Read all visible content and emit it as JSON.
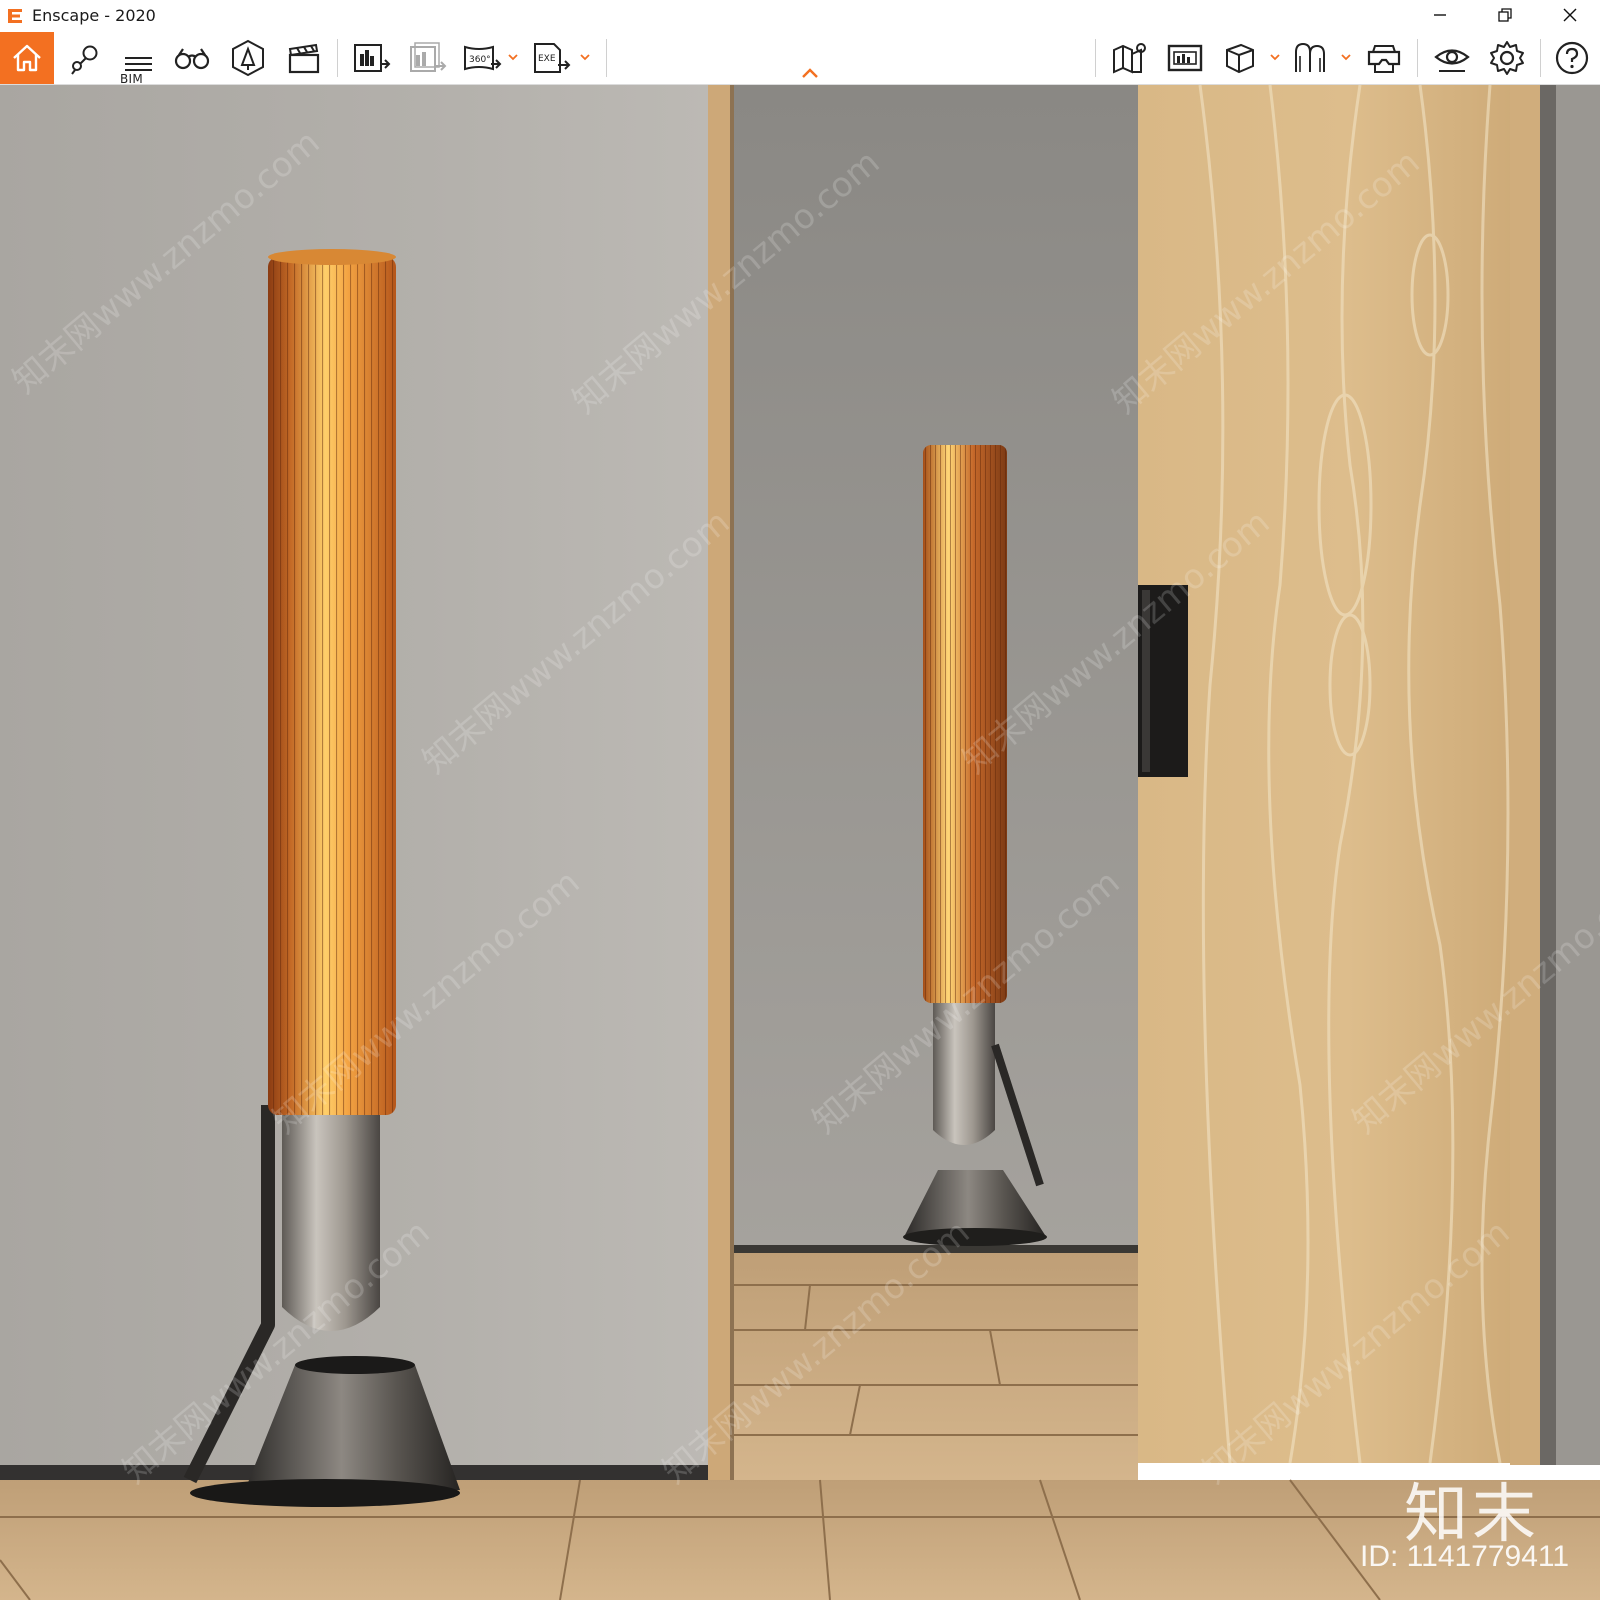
{
  "window": {
    "title": "Enscape - 2020",
    "controls": [
      "minimize",
      "restore",
      "close"
    ]
  },
  "toolbar": {
    "accent_color": "#f37021",
    "left_tools": [
      {
        "name": "home",
        "icon": "home-icon"
      },
      {
        "name": "views",
        "icon": "view-pins-icon"
      },
      {
        "name": "bim",
        "icon": "bim-icon",
        "label": "BIM"
      },
      {
        "name": "walk-mode",
        "icon": "binoculars-icon"
      },
      {
        "name": "assets",
        "icon": "asset-library-icon"
      },
      {
        "name": "video-editor",
        "icon": "clapperboard-icon"
      },
      {
        "name": "batch-render",
        "icon": "render-export-icon"
      },
      {
        "name": "batch-render-disabled",
        "icon": "batch-export-icon"
      },
      {
        "name": "panorama",
        "icon": "panorama-360-icon",
        "label": "360°"
      },
      {
        "name": "exe-export",
        "icon": "exe-export-icon",
        "label": "EXE"
      }
    ],
    "right_tools": [
      {
        "name": "map",
        "icon": "map-icon"
      },
      {
        "name": "capture",
        "icon": "capture-icon"
      },
      {
        "name": "sync",
        "icon": "cube-icon"
      },
      {
        "name": "collaborate",
        "icon": "figures-icon"
      },
      {
        "name": "vr",
        "icon": "vr-headset-icon"
      },
      {
        "name": "visual-settings",
        "icon": "eye-icon"
      },
      {
        "name": "settings",
        "icon": "gear-icon"
      },
      {
        "name": "help",
        "icon": "help-icon"
      }
    ]
  },
  "viewport": {
    "scene": "floor-lamp-render",
    "watermark_logo": "知末",
    "watermark_id": "ID: 1141779411",
    "watermark_url": "知末网www.znzmo.com"
  }
}
